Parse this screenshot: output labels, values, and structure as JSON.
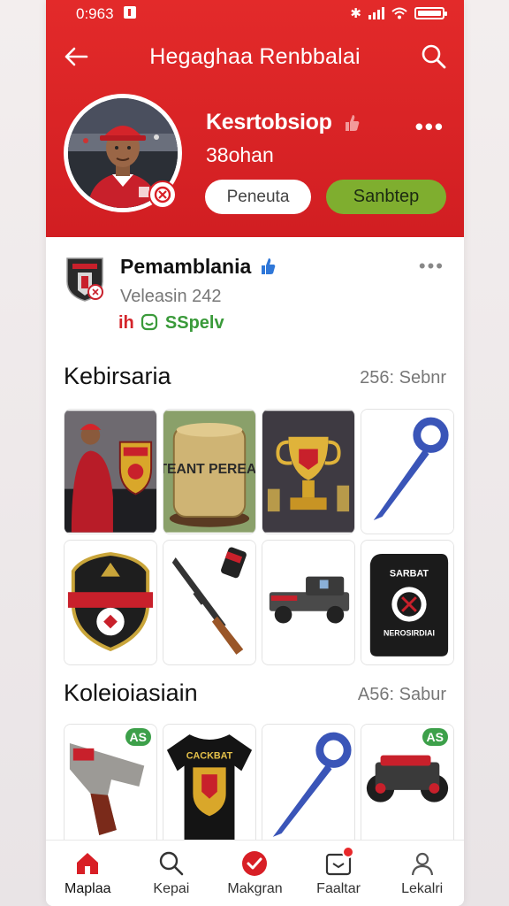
{
  "status_bar": {
    "time": "0:963"
  },
  "header": {
    "title": "Hegaghaa Renbbalai",
    "profile_name": "Kesrtobsiop",
    "profile_sub": "38ohan",
    "btn_primary": "Peneuta",
    "btn_secondary": "Sanbtep"
  },
  "team": {
    "name": "Pemamblania",
    "level": "Veleasin 242",
    "tag_left": "ih",
    "tag_right": "SSpelv"
  },
  "section1": {
    "title": "Kebirsaria",
    "count": "256: Sebnr"
  },
  "section2": {
    "title": "Koleioiasiain",
    "count": "A56: Sabur"
  },
  "items": {
    "jar_text": "TEANT PEREAI",
    "bag_text_top": "SARBAT",
    "bag_text_bottom": "NEROSIRDIAI",
    "shirt_text": "CACKBAT",
    "badge": "AS"
  },
  "bottom_nav": [
    {
      "label": "Maplaa",
      "icon": "home-icon"
    },
    {
      "label": "Kepai",
      "icon": "search-icon"
    },
    {
      "label": "Makgran",
      "icon": "check-circle-icon"
    },
    {
      "label": "Faaltar",
      "icon": "inbox-icon"
    },
    {
      "label": "Lekalri",
      "icon": "person-icon"
    }
  ],
  "colors": {
    "brand_red": "#d81f26",
    "accent_green": "#7fae2f",
    "verified_blue": "#2f77d8",
    "tag_green": "#3a9a3a"
  }
}
